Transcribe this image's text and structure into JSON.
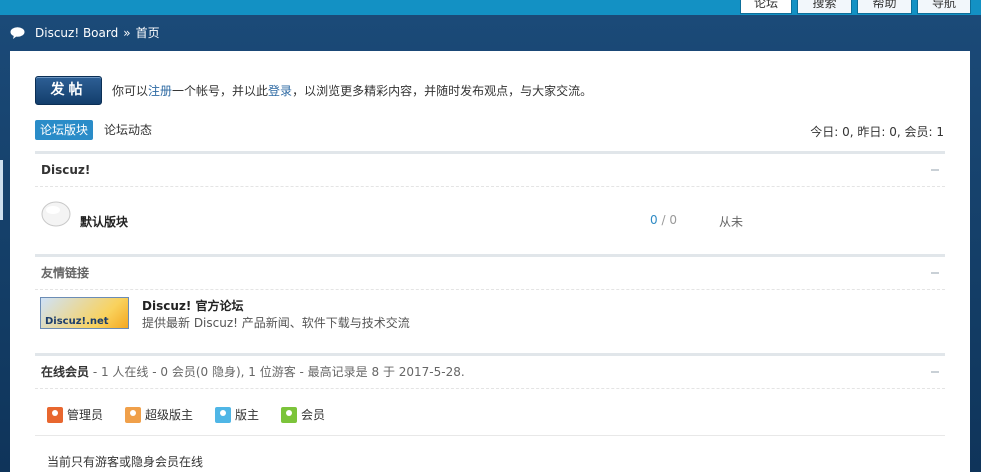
{
  "topnav": {
    "tabs": [
      "论坛",
      "搜索",
      "帮助",
      "导航"
    ]
  },
  "breadcrumb": {
    "site": "Discuz! Board",
    "separator": "»",
    "current": "首页"
  },
  "intro": {
    "post_button": "发帖",
    "text_before": "你可以",
    "register_link": "注册",
    "text_middle": "一个帐号，并以此",
    "login_link": "登录",
    "text_after": "，以浏览更多精彩内容，并随时发布观点，与大家交流。"
  },
  "subtabs": {
    "active": "论坛版块",
    "other": "论坛动态"
  },
  "stats": "今日: 0, 昨日: 0, 会员: 1",
  "category": {
    "title": "Discuz!",
    "forum": {
      "name": "默认版块",
      "threads": "0",
      "sep": " / ",
      "posts": "0",
      "last_post": "从未"
    }
  },
  "links": {
    "title": "友情链接",
    "item": {
      "logo_text": "Discuz!.net",
      "name": "Discuz! 官方论坛",
      "desc": "提供最新 Discuz! 产品新闻、软件下载与技术交流"
    }
  },
  "online": {
    "label": "在线会员",
    "summary": " - 1 人在线 - 0 会员(0 隐身), 1 位游客 - 最高记录是 8 于 2017-5-28.",
    "legend": [
      {
        "label": "管理员",
        "color": "#e8672f"
      },
      {
        "label": "超级版主",
        "color": "#f0a04a"
      },
      {
        "label": "版主",
        "color": "#4fb6e6"
      },
      {
        "label": "会员",
        "color": "#7cc43a"
      }
    ],
    "note": "当前只有游客或隐身会员在线"
  }
}
